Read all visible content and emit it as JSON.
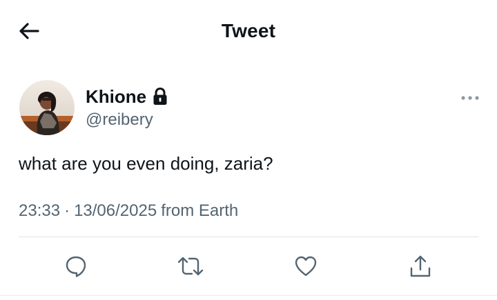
{
  "header": {
    "title": "Tweet",
    "back_icon": "arrow-left-icon"
  },
  "tweet": {
    "author": {
      "display_name": "Khione",
      "handle": "@reibery",
      "protected_icon": "lock-icon"
    },
    "text": "what are you even doing, zaria?",
    "time": "23:33",
    "separator": "·",
    "date": "13/06/2025",
    "source": "from Earth",
    "more_icon": "more-horizontal-icon"
  },
  "actions": [
    {
      "name": "reply",
      "icon": "reply-icon"
    },
    {
      "name": "retweet",
      "icon": "retweet-icon"
    },
    {
      "name": "like",
      "icon": "heart-icon"
    },
    {
      "name": "share",
      "icon": "share-icon"
    }
  ],
  "colors": {
    "text_primary": "#0f1419",
    "text_secondary": "#536471",
    "divider": "#dfe3e6"
  }
}
